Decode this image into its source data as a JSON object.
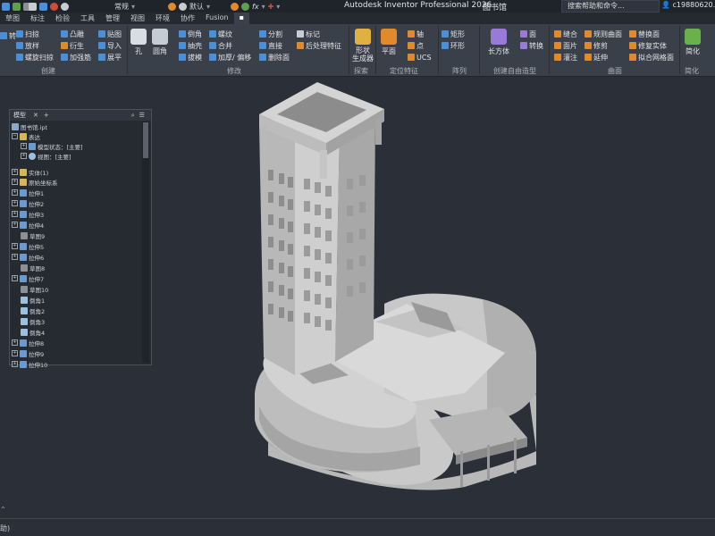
{
  "title_bar": {
    "app_title": "Autodesk Inventor Professional 2026",
    "doc_name": "图书馆",
    "search_placeholder": "搜索帮助和命令...",
    "user": "c19880620...",
    "style_value": "常规",
    "material_value": "默认"
  },
  "tabs": [
    "草图",
    "标注",
    "检验",
    "工具",
    "管理",
    "视图",
    "环境",
    "协作",
    "Fusion",
    "▪"
  ],
  "ribbon": {
    "groups": {
      "create": "创建",
      "modify": "修改",
      "explore": "探索",
      "locate": "定位特征",
      "pattern": "阵列",
      "freeform": "创建自由造型",
      "surface": "曲面",
      "simplify": "简化"
    },
    "buttons": {
      "rotate": "转",
      "sweep": "扫掠",
      "loft": "放样",
      "coil": "螺旋扫掠",
      "emboss": "凸雕",
      "derive": "衍生",
      "rib": "加强筋",
      "decal": "贴图",
      "import": "导入",
      "unfold": "展平",
      "hole": "孔",
      "fillet": "圆角",
      "chamfer": "倒角",
      "shell": "抽壳",
      "draft": "拔模",
      "thread": "螺纹",
      "combine": "合并",
      "thicken": "加厚/ 偏移",
      "split": "分割",
      "direct": "直接",
      "delete_face": "删除面",
      "mark": "标记",
      "post_process": "后处理特征",
      "shape_gen": "形状\n生成器",
      "plane": "平面",
      "axis": "轴",
      "point": "点",
      "ucs": "UCS",
      "rect": "矩形",
      "circular": "环形",
      "box": "长方体",
      "face": "面",
      "convert": "转换",
      "stitch": "缝合",
      "patch": "面片",
      "sculpt": "灌注",
      "ruled": "规则曲面",
      "trim": "修剪",
      "extend": "延伸",
      "replace_face": "替换面",
      "repair": "修复实体",
      "fit_mesh": "拟合网格面",
      "simplify_btn": "简化"
    }
  },
  "browser": {
    "tab_label": "模型",
    "root": "图书馆.ipt",
    "items": [
      {
        "label": "表达",
        "level": 1,
        "icon": "folder"
      },
      {
        "label": "模型状态：[主要]",
        "level": 2,
        "icon": "state"
      },
      {
        "label": "视图：[主要]",
        "level": 2,
        "icon": "view"
      },
      {
        "label": "实体(1)",
        "level": 1,
        "icon": "folder"
      },
      {
        "label": "原始坐标系",
        "level": 1,
        "icon": "folder"
      },
      {
        "label": "拉伸1",
        "level": 1,
        "icon": "extrude"
      },
      {
        "label": "拉伸2",
        "level": 1,
        "icon": "extrude"
      },
      {
        "label": "拉伸3",
        "level": 1,
        "icon": "extrude"
      },
      {
        "label": "拉伸4",
        "level": 1,
        "icon": "extrude"
      },
      {
        "label": "草图9",
        "level": 1,
        "icon": "sketch"
      },
      {
        "label": "拉伸5",
        "level": 1,
        "icon": "extrude"
      },
      {
        "label": "拉伸6",
        "level": 1,
        "icon": "extrude"
      },
      {
        "label": "草图8",
        "level": 1,
        "icon": "sketch"
      },
      {
        "label": "拉伸7",
        "level": 1,
        "icon": "extrude"
      },
      {
        "label": "草图10",
        "level": 1,
        "icon": "sketch"
      },
      {
        "label": "倒角1",
        "level": 1,
        "icon": "chamfer"
      },
      {
        "label": "倒角2",
        "level": 1,
        "icon": "chamfer"
      },
      {
        "label": "倒角3",
        "level": 1,
        "icon": "chamfer"
      },
      {
        "label": "倒角4",
        "level": 1,
        "icon": "chamfer"
      },
      {
        "label": "拉伸8",
        "level": 1,
        "icon": "extrude"
      },
      {
        "label": "拉伸9",
        "level": 1,
        "icon": "extrude"
      },
      {
        "label": "拉伸10",
        "level": 1,
        "icon": "extrude"
      }
    ]
  },
  "status": {
    "text": "助)"
  },
  "colors": {
    "background": "#2b3038",
    "ribbon": "#3a4049",
    "accent_orange": "#e08a2c",
    "accent_blue": "#4a90d9",
    "model_gray": "#9a9a9a"
  }
}
